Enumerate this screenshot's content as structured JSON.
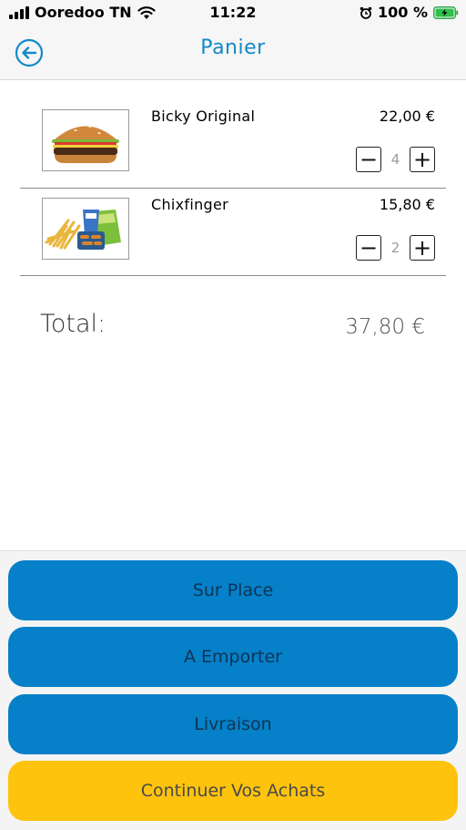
{
  "status_bar": {
    "carrier": "Ooredoo TN",
    "time": "11:22",
    "battery": "100 %"
  },
  "nav": {
    "title": "Panier",
    "back_icon": "back-arrow-icon"
  },
  "colors": {
    "accent": "#1289c8",
    "primary_button": "#0680c8",
    "secondary_button": "#fec30d"
  },
  "cart": {
    "items": [
      {
        "name": "Bicky Original",
        "price": "22,00 €",
        "quantity": "4",
        "image": "burger-image"
      },
      {
        "name": "Chixfinger",
        "price": "15,80 €",
        "quantity": "2",
        "image": "fries-meal-image"
      }
    ],
    "total_label": "Total:",
    "total_value": "37,80 €"
  },
  "actions": {
    "sur_place": "Sur Place",
    "a_emporter": "A Emporter",
    "livraison": "Livraison",
    "continuer": "Continuer Vos Achats"
  }
}
